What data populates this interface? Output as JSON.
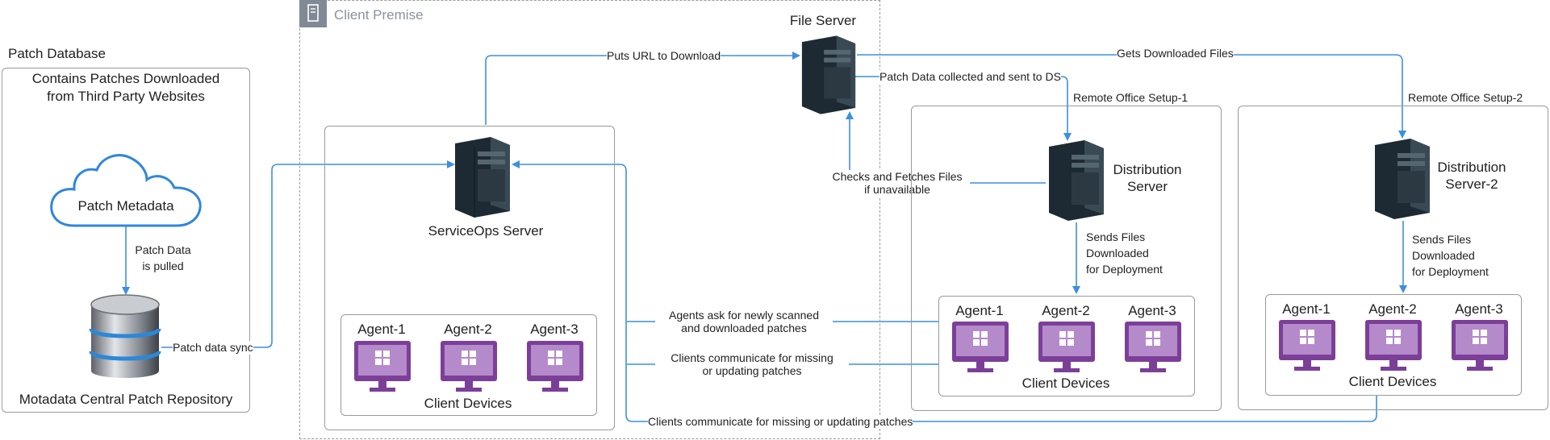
{
  "patch_db": {
    "title": "Patch Database",
    "desc_line1": "Contains Patches Downloaded",
    "desc_line2": "from Third Party Websites",
    "cloud_label": "Patch Metadata",
    "pull_line1": "Patch Data",
    "pull_line2": "is pulled",
    "repo_label": "Motadata Central Patch Repository",
    "sync_label": "Patch data sync"
  },
  "client_premise": {
    "title": "Client Premise",
    "serviceops_label": "ServiceOps Server",
    "puts_url": "Puts URL to Download",
    "devices_label": "Client Devices",
    "agents": [
      "Agent-1",
      "Agent-2",
      "Agent-3"
    ]
  },
  "file_server": {
    "label": "File Server",
    "patch_collected": "Patch Data collected and sent to DS",
    "gets_files": "Gets Downloaded Files",
    "checks_line1": "Checks and Fetches Files",
    "checks_line2": "if unavailable"
  },
  "remote1": {
    "title": "Remote Office Setup-1",
    "server_line1": "Distribution",
    "server_line2": "Server",
    "sends_line1": "Sends Files",
    "sends_line2": "Downloaded",
    "sends_line3": "for Deployment",
    "devices_label": "Client Devices",
    "agents": [
      "Agent-1",
      "Agent-2",
      "Agent-3"
    ]
  },
  "remote2": {
    "title": "Remote Office Setup-2",
    "server_line1": "Distribution",
    "server_line2": "Server-2",
    "sends_line1": "Sends Files",
    "sends_line2": "Downloaded",
    "sends_line3": "for Deployment",
    "devices_label": "Client Devices",
    "agents": [
      "Agent-1",
      "Agent-2",
      "Agent-3"
    ]
  },
  "flows": {
    "agents_ask_line1": "Agents ask for newly scanned",
    "agents_ask_line2": "and downloaded patches",
    "clients_comm_line1": "Clients communicate for missing",
    "clients_comm_line2": "or updating patches",
    "clients_comm_bottom": "Clients communicate for missing or updating patches"
  },
  "colors": {
    "arrow": "#3d8fe0",
    "box_border": "#9a9a9a",
    "monitor": "#7c3f98",
    "server": "#1e2a33",
    "cloud": "#2f86dc"
  }
}
